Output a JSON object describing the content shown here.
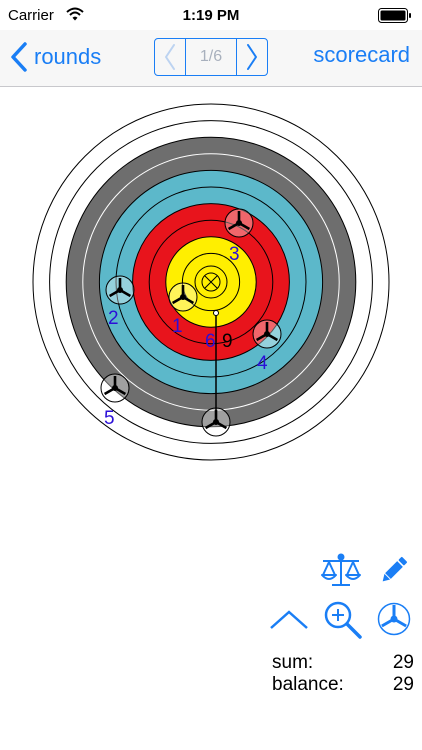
{
  "status_bar": {
    "carrier": "Carrier",
    "time": "1:19 PM"
  },
  "nav": {
    "back_label": "rounds",
    "page_indicator": "1/6",
    "right_label": "scorecard"
  },
  "target": {
    "ring_colors": {
      "white": "#ffffff",
      "black": "#6e6e6e",
      "blue": "#5cb8ca",
      "red": "#e8141c",
      "gold": "#ffef00"
    },
    "arrows": [
      {
        "label": "1",
        "label_color": "#2b0fd8"
      },
      {
        "label": "2",
        "label_color": "#2b0fd8"
      },
      {
        "label": "3",
        "label_color": "#2b0fd8"
      },
      {
        "label": "4",
        "label_color": "#2b0fd8"
      },
      {
        "label": "5",
        "label_color": "#2b0fd8"
      },
      {
        "label": "6",
        "label_color": "#2b0fd8"
      }
    ],
    "group_score": "9"
  },
  "tools": {
    "balance_icon": "scale-icon",
    "edit_icon": "pencil-icon",
    "collapse_icon": "chevron-up-icon",
    "zoom_icon": "zoom-in-icon",
    "arrow_icon": "arrow-nock-icon",
    "accent": "#1a7ef5"
  },
  "stats": {
    "sum_label": "sum:",
    "sum_value": "29",
    "balance_label": "balance:",
    "balance_value": "29"
  }
}
